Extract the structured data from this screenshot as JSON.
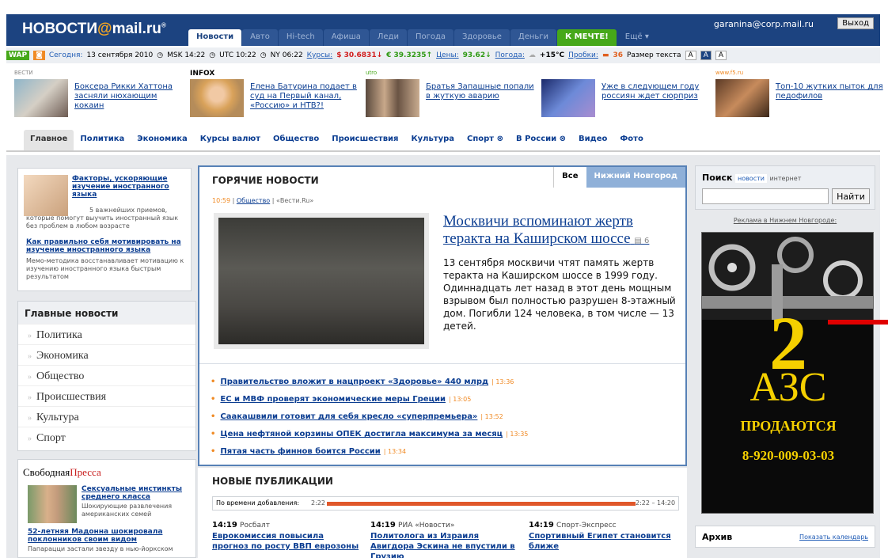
{
  "header": {
    "logo_part1": "НОВОСТИ",
    "logo_at": "@",
    "logo_part2": "mail.ru",
    "logo_mark": "®",
    "user": "garanina@corp.mail.ru",
    "logout": "Выход",
    "tabs": [
      "Новости",
      "Авто",
      "Hi-tech",
      "Афиша",
      "Леди",
      "Погода",
      "Здоровье",
      "Деньги",
      "К МЕЧТЕ!",
      "Ещё ▾"
    ]
  },
  "infobar": {
    "wap": "WAP",
    "today_label": "Сегодня:",
    "today": "13 сентября 2010",
    "msk": "MSK 14:22",
    "utc": "UTC 10:22",
    "ny": "NY 06:22",
    "rates_label": "Курсы:",
    "usd": "$ 30.6831↓",
    "eur": "€ 39.3235↑",
    "prices_label": "Цены:",
    "oil": "93.62↓",
    "weather_label": "Погода:",
    "temp": "+15°C",
    "traffic_label": "Пробки:",
    "traffic": "36",
    "size_label": "Размер текста",
    "sizes": [
      "A",
      "A",
      "A"
    ]
  },
  "teasers": [
    {
      "src": "ВЕСТИ",
      "text": "Боксера Рикки Хаттона засняли нюхающим кокаин"
    },
    {
      "src": "INFOX",
      "text": "Елена Батурина подает в суд на Первый канал, «Россию» и НТВ?!"
    },
    {
      "src": "utro",
      "text": "Братья Запашные попали в жуткую аварию"
    },
    {
      "src": "",
      "text": "Уже в следующем году россиян ждет сюрприз"
    },
    {
      "src": "www.f5.ru",
      "text": "Топ-10 жутких пыток для педофилов"
    }
  ],
  "rubrics": [
    "Главное",
    "Политика",
    "Экономика",
    "Курсы валют",
    "Общество",
    "Происшествия",
    "Культура",
    "Спорт ⊗",
    "В России ⊗",
    "Видео",
    "Фото"
  ],
  "left": {
    "ad_title": "Факторы, ускоряющие изучение иностранного языка",
    "ad_sub": "5 важнейших приемов, которые помогут выучить иностранный язык без проблем в любом возрасте",
    "ad2_title": "Как правильно себя мотивировать на изучение иностранного языка",
    "ad2_sub": "Мемо-методика восстанавливает мотивацию к изучению иностранного языка быстрым результатом",
    "main_news_title": "Главные новости",
    "main_news": [
      "Политика",
      "Экономика",
      "Общество",
      "Происшествия",
      "Культура",
      "Спорт"
    ],
    "press_title1": "Свободная",
    "press_title2": "Пресса",
    "press1_title": "Сексуальные инстинкты среднего класса",
    "press1_sub": "Шокирующие развлечения американских семей",
    "press2_title": "52-летняя Мадонна шокировала поклонников своим видом",
    "press2_sub": "Папарацци застали звезду в нью-йоркском"
  },
  "hot": {
    "title": "ГОРЯЧИЕ НОВОСТИ",
    "tab_all": "Все",
    "tab_region": "Нижний Новгород",
    "time": "10:59",
    "rubric": "Общество",
    "source": "«Вести.Ru»",
    "headline": "Москвичи вспоминают жертв теракта на Каширском шоссе",
    "photos": "6",
    "lead": "13 сентября москвичи чтят память жертв теракта на Каширском шоссе в 1999 году. Одиннадцать лет назад в этот день мощным взрывом был полностью разрушен 8-этажный дом. Погибли 124 человека, в том числе — 13 детей.",
    "items": [
      {
        "text": "Правительство вложит в нацпроект «Здоровье» 440 млрд",
        "time": "13:36"
      },
      {
        "text": "ЕС и МВФ проверят экономические меры Греции",
        "time": "13:05"
      },
      {
        "text": "Саакашвили готовит для себя кресло «суперпремьера»",
        "time": "13:52"
      },
      {
        "text": "Цена нефтяной корзины ОПЕК достигла максимума за месяц",
        "time": "13:35"
      },
      {
        "text": "Пятая часть финнов боится России",
        "time": "13:34"
      }
    ]
  },
  "newpub": {
    "title": "НОВЫЕ ПУБЛИКАЦИИ",
    "sort_label": "По времени добавления:",
    "start": "2:22",
    "range": "2:22 – 14:20",
    "items": [
      {
        "time": "14:19",
        "src": "Росбалт",
        "text": "Еврокомиссия повысила прогноз по росту ВВП еврозоны"
      },
      {
        "time": "14:19",
        "src": "РИА «Новости»",
        "text": "Политолога из Израиля Авигдора Эскина не впустили в Грузию"
      },
      {
        "time": "14:19",
        "src": "Спорт-Экспресс",
        "text": "Спортивный Египет становится ближе"
      }
    ]
  },
  "right": {
    "search_title": "Поиск",
    "search_opt1": "новости",
    "search_opt2": "интернет",
    "search_button": "Найти",
    "ad_label": "Реклама в Нижнем Новгороде:",
    "banner_num": "2",
    "banner_big": "АЗС",
    "banner_sub": "ПРОДАЮТСЯ",
    "banner_phone": "8-920-009-03-03",
    "archive": "Архив",
    "calendar": "Показать календарь"
  }
}
